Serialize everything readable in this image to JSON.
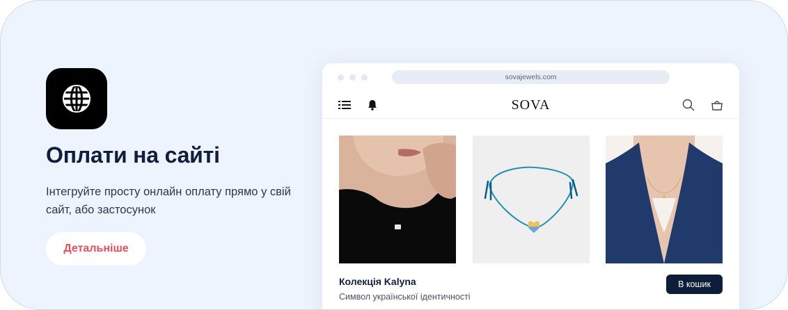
{
  "promo": {
    "icon": "globe-icon",
    "title": "Оплати на сайті",
    "description": "Інтегруйте просту онлайн оплату прямо у свій сайт, або застосунок",
    "more_label": "Детальніше",
    "colors": {
      "background": "#eef4fd",
      "title": "#0f1d3f",
      "accent": "#ef4e54"
    }
  },
  "browser": {
    "url": "sovajewels.com",
    "icons": {
      "menu": "list-menu-icon",
      "notifications": "bell-icon",
      "search": "search-icon",
      "cart": "cart-icon"
    },
    "store_logo": "SOVA",
    "products": [
      {
        "image": "woman-black-top-pendant"
      },
      {
        "image": "blue-bracelet-heart"
      },
      {
        "image": "woman-blue-blazer-necklace"
      }
    ],
    "collection_name": "Колекція Kalyna",
    "collection_subtitle": "Символ української ідентичності",
    "add_to_cart_label": "В кошик",
    "colors": {
      "button": "#0d1e3b"
    }
  }
}
